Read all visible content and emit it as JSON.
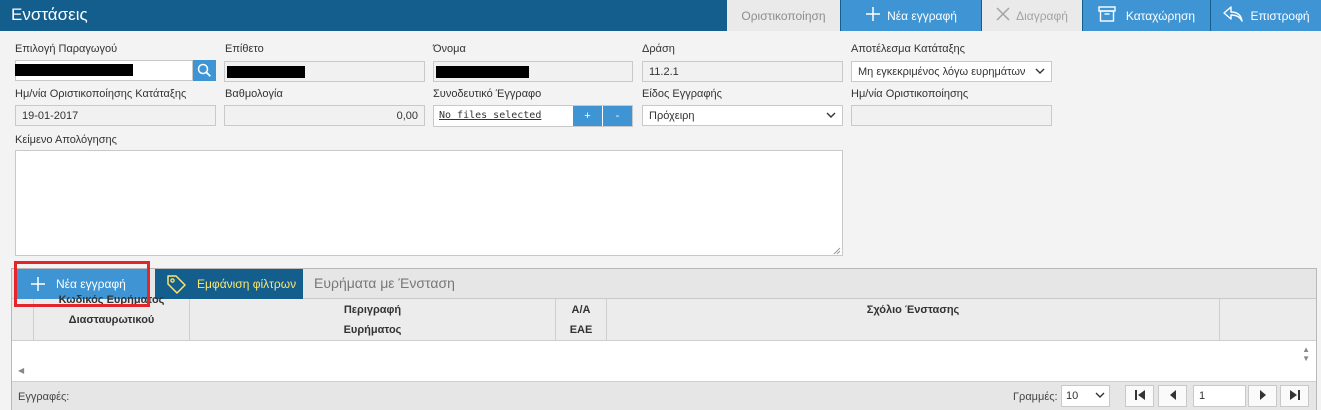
{
  "header": {
    "title": "Ενστάσεις",
    "buttons": {
      "finalize": "Οριστικοποίηση",
      "new_record": "Νέα εγγραφή",
      "delete": "Διαγραφή",
      "save": "Καταχώρηση",
      "back": "Επιστροφή"
    }
  },
  "form": {
    "producer": {
      "label": "Επιλογή Παραγωγού",
      "value": ""
    },
    "surname": {
      "label": "Επίθετο",
      "value": ""
    },
    "name": {
      "label": "Όνομα",
      "value": ""
    },
    "action": {
      "label": "Δράση",
      "value": "11.2.1"
    },
    "ranking_result": {
      "label": "Αποτέλεσμα Κατάταξης",
      "value": "Μη εγκεκριμένος λόγω ευρημάτων"
    },
    "ranking_final_date": {
      "label": "Ημ/νία Οριστικοποίησης Κατάταξης",
      "value": "19-01-2017"
    },
    "score": {
      "label": "Βαθμολογία",
      "value": "0,00"
    },
    "attached_document": {
      "label": "Συνοδευτικό Έγγραφο",
      "value": "No files selected",
      "plus": "+",
      "minus": "-"
    },
    "record_type": {
      "label": "Είδος Εγγραφής",
      "value": "Πρόχειρη"
    },
    "finalize_date": {
      "label": "Ημ/νία Οριστικοποίησης",
      "value": ""
    },
    "justification": {
      "label": "Κείμενο Απολόγησης",
      "value": ""
    }
  },
  "grid": {
    "tabs": {
      "new_record": "Νέα εγγραφή",
      "show_filters": "Εμφάνιση φίλτρων",
      "findings": "Ευρήματα με Ένσταση"
    },
    "columns": [
      {
        "line1": "Κωδικός Ευρήματος",
        "line2": "Διασταυρωτικού"
      },
      {
        "line1": "Περιγραφή",
        "line2": "Ευρήματος"
      },
      {
        "line1": "Α/Α",
        "line2": "ΕΑΕ"
      },
      {
        "line1": "Σχόλιο Ένστασης",
        "line2": ""
      }
    ],
    "footer": {
      "records_label": "Εγγραφές:",
      "rows_label": "Γραμμές:",
      "rows_value": "10",
      "page": "1"
    }
  },
  "colors": {
    "header_bg": "#145e8e",
    "accent": "#3f95d4",
    "highlight": "#e3262c"
  },
  "icons": [
    "plus-icon",
    "close-icon",
    "archive-icon",
    "back-arrow-icon",
    "search-icon",
    "tag-icon",
    "chevron-down-icon",
    "first-page-icon",
    "prev-page-icon",
    "next-page-icon",
    "last-page-icon"
  ]
}
